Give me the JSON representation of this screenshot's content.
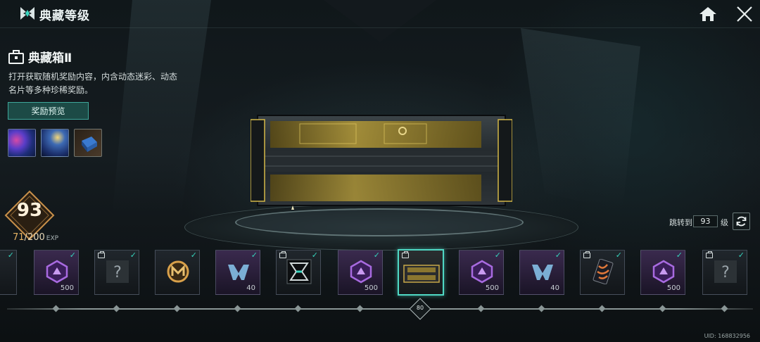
{
  "header": {
    "title": "典藏等级",
    "home_icon": "home-icon",
    "close_icon": "close-icon"
  },
  "box": {
    "title": "典藏箱Ⅱ",
    "description": "打开获取随机奖励内容，内含动态迷彩、动态名片等多种珍稀奖励。",
    "preview_button": "奖励预览",
    "thumbnails": [
      "galaxy-camo",
      "starry-night-camo",
      "treasure-chest-item"
    ]
  },
  "level": {
    "current": "93",
    "exp_current": "71",
    "exp_separator": "/",
    "exp_max": "200",
    "exp_unit": "EXP"
  },
  "jump": {
    "label": "跳转到",
    "value": "93",
    "unit": "级"
  },
  "rewards": [
    {
      "type": "partial",
      "checked": true,
      "qty": ""
    },
    {
      "type": "purple-crystal",
      "checked": true,
      "qty": "500"
    },
    {
      "type": "mystery",
      "checked": true,
      "tag": true,
      "qty": ""
    },
    {
      "type": "gold-m-token",
      "checked": true,
      "qty": ""
    },
    {
      "type": "m-emblem",
      "checked": true,
      "qty": "40"
    },
    {
      "type": "banner-card",
      "checked": true,
      "tag": true,
      "qty": ""
    },
    {
      "type": "purple-crystal",
      "checked": true,
      "qty": "500"
    },
    {
      "type": "chest-selected",
      "checked": false,
      "tag": true,
      "qty": ""
    },
    {
      "type": "purple-crystal",
      "checked": true,
      "qty": "500"
    },
    {
      "type": "m-emblem",
      "checked": true,
      "qty": "40"
    },
    {
      "type": "dynamic-card",
      "checked": true,
      "tag": true,
      "qty": ""
    },
    {
      "type": "purple-crystal",
      "checked": true,
      "qty": "500"
    },
    {
      "type": "mystery",
      "checked": true,
      "tag": true,
      "qty": ""
    }
  ],
  "timeline": {
    "current_marker": "80"
  },
  "uid": "UID: 168832956",
  "colors": {
    "accent": "#36d4bc",
    "gold": "#e7b463",
    "purple": "#8a4fd0"
  }
}
